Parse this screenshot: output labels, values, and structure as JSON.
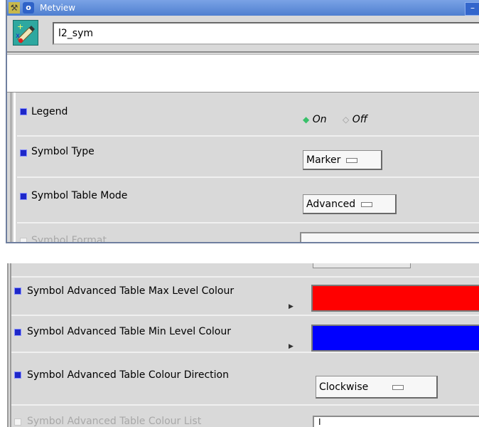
{
  "window": {
    "title": "Metview",
    "icon_name": "metview-app-icon",
    "name_value": "l2_sym"
  },
  "params_top": [
    {
      "label": "Legend",
      "enabled": true,
      "on_label": "On",
      "off_label": "Off",
      "selected": "On"
    },
    {
      "label": "Symbol Type",
      "enabled": true,
      "value": "Marker"
    },
    {
      "label": "Symbol Table Mode",
      "enabled": true,
      "value": "Advanced"
    },
    {
      "label": "Symbol Format",
      "enabled": false
    }
  ],
  "params_bottom": [
    {
      "label": "Symbol Advanced Table Max Level Colour",
      "enabled": true,
      "colour": "#ff0000"
    },
    {
      "label": "Symbol Advanced Table Min Level Colour",
      "enabled": true,
      "colour": "#0000ff"
    },
    {
      "label": "Symbol Advanced Table Colour Direction",
      "enabled": true,
      "value": "Clockwise"
    },
    {
      "label": "Symbol Advanced Table Colour List",
      "enabled": false,
      "value": "I"
    }
  ],
  "colors": {
    "titlebar": "#4f7fd0",
    "bullet_on": "#1d27c9",
    "radio_on": "#39c06a",
    "max_colour": "#ff0000",
    "min_colour": "#0000ff"
  }
}
